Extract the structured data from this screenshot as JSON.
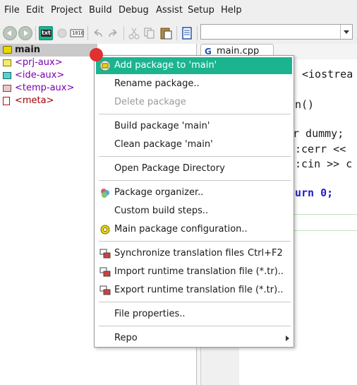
{
  "menubar": {
    "items": [
      "File",
      "Edit",
      "Project",
      "Build",
      "Debug",
      "Assist",
      "Setup",
      "Help"
    ]
  },
  "toolbar": {
    "txt_label": "txt",
    "bin_label": "1010",
    "combo_value": ""
  },
  "tree": {
    "package": "main",
    "children": [
      "<prj-aux>",
      "<ide-aux>",
      "<temp-aux>",
      "<meta>"
    ]
  },
  "editor": {
    "tab_label": "main.cpp",
    "lines": [
      "<iostrea",
      "n()",
      "r dummy;",
      ":cerr <<",
      ":cin >> c",
      "urn 0;"
    ]
  },
  "context_menu": {
    "items": [
      {
        "label": "Add package to 'main'",
        "icon": "add-package-icon",
        "state": "active"
      },
      {
        "label": "Rename package..",
        "state": "normal"
      },
      {
        "label": "Delete package",
        "state": "disabled"
      },
      {
        "label": "Build package 'main'",
        "state": "normal"
      },
      {
        "label": "Clean package 'main'",
        "state": "normal"
      },
      {
        "label": "Open Package Directory",
        "state": "normal"
      },
      {
        "label": "Package organizer..",
        "icon": "package-organizer-icon",
        "state": "normal"
      },
      {
        "label": "Custom build steps..",
        "state": "normal"
      },
      {
        "label": "Main package configuration..",
        "icon": "configuration-icon",
        "state": "normal"
      },
      {
        "label": "Synchronize translation files",
        "shortcut": "Ctrl+F2",
        "icon": "translation-icon",
        "state": "normal"
      },
      {
        "label": "Import runtime translation file (*.tr)..",
        "icon": "translation-icon",
        "state": "normal"
      },
      {
        "label": "Export runtime translation file (*.tr)..",
        "icon": "translation-icon",
        "state": "normal"
      },
      {
        "label": "File properties..",
        "state": "normal"
      },
      {
        "label": "Repo",
        "state": "submenu"
      }
    ]
  },
  "colors": {
    "accent": "#1bb48f",
    "package": "#e8d800",
    "tree_text": "#7a00b0",
    "keyword": "#2020c0",
    "number": "#a00000"
  }
}
